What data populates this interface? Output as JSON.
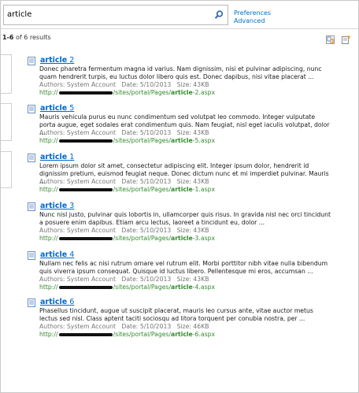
{
  "search": {
    "query": "article"
  },
  "links": {
    "preferences": "Preferences",
    "advanced": "Advanced"
  },
  "results_info": {
    "range": "1-6",
    "total_text": "of 6 results"
  },
  "results": [
    {
      "title_hit": "article",
      "title_num": "2",
      "summary": "Donec pharetra fermentum magna id varius. Nam dignissim, nisi et pulvinar adipiscing, nunc quam hendrerit turpis, eu luctus dolor libero quis est. Donec dapibus, nisi vitae placerat ...",
      "authors": "Authors: System Account",
      "date": "Date: 5/10/2013",
      "size": "Size: 43KB",
      "url_prefix": "http://",
      "url_hit": "article",
      "url_path": "/sites/portal/Pages/",
      "url_file": "-2.aspx"
    },
    {
      "title_hit": "article",
      "title_num": "5",
      "summary": "Mauris vehicula purus eu nunc condimentum sed volutpat leo commodo. Integer vulputate porta augue, eget sodales erat condimentum quis. Nam feugiat, nisl eget iaculis volutpat, dolor ...",
      "authors": "Authors: System Account",
      "date": "Date: 5/10/2013",
      "size": "Size: 43KB",
      "url_prefix": "http://",
      "url_hit": "article",
      "url_path": "/sites/portal/Pages/",
      "url_file": "-5.aspx"
    },
    {
      "title_hit": "article",
      "title_num": "1",
      "summary": "Lorem ipsum dolor sit amet, consectetur adipiscing elit. Integer ipsum dolor, hendrerit id dignissim pretium, euismod feugiat neque. Donec dictum nunc et mi imperdiet pulvinar. Mauris ...",
      "authors": "Authors: System Account",
      "date": "Date: 5/10/2013",
      "size": "Size: 43KB",
      "url_prefix": "http://",
      "url_hit": "article",
      "url_path": "/sites/portal/Pages/",
      "url_file": "-1.aspx"
    },
    {
      "title_hit": "article",
      "title_num": "3",
      "summary": "Nunc nisl justo, pulvinar quis lobortis in, ullamcorper quis risus. In gravida nisl nec orci tincidunt a posuere enim dapibus. Etiam arcu lectus, laoreet a tincidunt eu, dolor ...",
      "authors": "Authors: System Account",
      "date": "Date: 5/10/2013",
      "size": "Size: 43KB",
      "url_prefix": "http://",
      "url_hit": "article",
      "url_path": "/sites/portal/Pages/",
      "url_file": "-3.aspx"
    },
    {
      "title_hit": "article",
      "title_num": "4",
      "summary": "Nullam nec felis ac nisi rutrum ornare vel rutrum elit. Morbi porttitor nibh vitae nulla bibendum quis viverra ipsum consequat. Quisque id luctus libero. Pellentesque mi eros, accumsan ...",
      "authors": "Authors: System Account",
      "date": "Date: 5/10/2013",
      "size": "Size: 43KB",
      "url_prefix": "http://",
      "url_hit": "article",
      "url_path": "/sites/portal/Pages/",
      "url_file": "-4.aspx"
    },
    {
      "title_hit": "article",
      "title_num": "6",
      "summary": "Phasellus tincidunt, augue ut suscipit placerat, mauris leo cursus ante, vitae auctor metus lectus sed nisl. Class aptent taciti sociosqu ad litora torquent per conubia nostra, per ...",
      "authors": "Authors: System Account",
      "date": "Date: 5/10/2013",
      "size": "Size: 46KB",
      "url_prefix": "http://",
      "url_hit": "article",
      "url_path": "/sites/portal/Pages/",
      "url_file": "-6.aspx"
    }
  ],
  "icons": {
    "search": "magnifier-icon",
    "rss": "rss-feed-icon",
    "alert": "alert-me-icon",
    "doc": "document-page-icon"
  },
  "colors": {
    "link": "#0066cc",
    "url": "#338a2e",
    "meta": "#777777"
  }
}
